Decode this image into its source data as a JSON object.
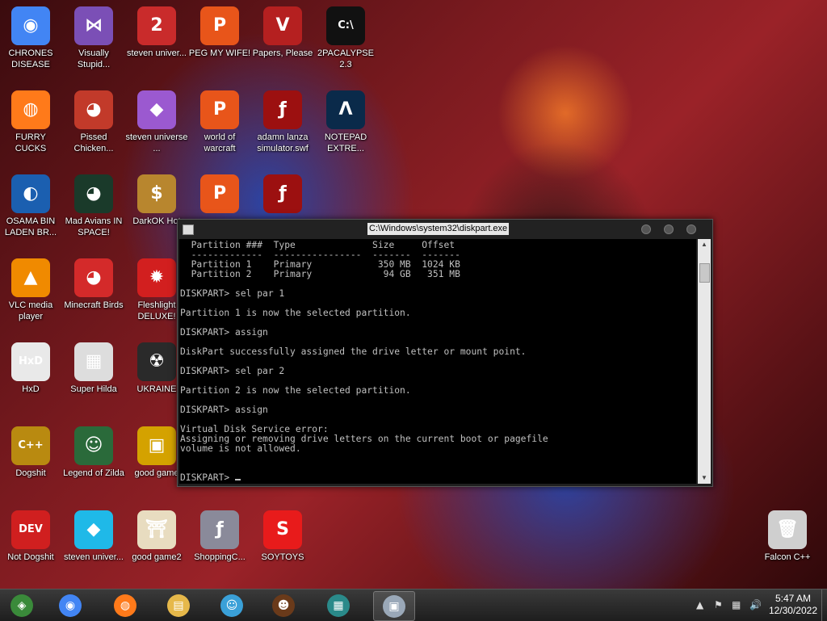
{
  "desktop": {
    "icons": [
      {
        "label": "CHRONES DISEASE",
        "icon": "chrome-icon",
        "color": "#4285f4",
        "glyph": "◉"
      },
      {
        "label": "Visually Stupid...",
        "icon": "visual-studio-icon",
        "color": "#7b4fb6",
        "glyph": "⋈"
      },
      {
        "label": "steven univer...",
        "icon": "pokemon-2-icon",
        "color": "#c92b2b",
        "glyph": "2"
      },
      {
        "label": "PEG MY WIFE!",
        "icon": "p-logo-icon",
        "color": "#e8551a",
        "glyph": "P"
      },
      {
        "label": "Papers, Please",
        "icon": "papers-please-icon",
        "color": "#b52020",
        "glyph": "V"
      },
      {
        "label": "2PACALYPSE 2.3",
        "icon": "cmd-icon",
        "color": "#111111",
        "glyph": "C:\\"
      },
      {
        "label": "FURRY CUCKS",
        "icon": "firefox-icon",
        "color": "#ff7a1a",
        "glyph": "◍"
      },
      {
        "label": "Pissed Chicken...",
        "icon": "angry-birds-seasons-icon",
        "color": "#c23a2a",
        "glyph": "◕"
      },
      {
        "label": "steven universe ...",
        "icon": "gem-icon",
        "color": "#9b59d0",
        "glyph": "◆"
      },
      {
        "label": "world of warcraft",
        "icon": "p-logo-icon",
        "color": "#e8551a",
        "glyph": "P"
      },
      {
        "label": "adamn lanza simulator.swf",
        "icon": "flash-icon",
        "color": "#9c1010",
        "glyph": "ƒ"
      },
      {
        "label": "NOTEPAD EXTRE...",
        "icon": "notepad-extreme-icon",
        "color": "#0a2a4a",
        "glyph": "Λ"
      },
      {
        "label": "OSAMA BIN LADEN BR...",
        "icon": "obama-logo-icon",
        "color": "#1b5fb0",
        "glyph": "◐"
      },
      {
        "label": "Mad Avians IN SPACE!",
        "icon": "angry-birds-space-icon",
        "color": "#1a3a2a",
        "glyph": "◕"
      },
      {
        "label": "DarkOK Hot",
        "icon": "money-bag-icon",
        "color": "#b8862e",
        "glyph": "$"
      },
      {
        "label": "VLC media player",
        "icon": "vlc-icon",
        "color": "#f08a00",
        "glyph": "▲"
      },
      {
        "label": "Minecraft Birds",
        "icon": "angry-birds-icon",
        "color": "#d42a2a",
        "glyph": "◕"
      },
      {
        "label": "Fleshlight DELUXE!",
        "icon": "red-monster-icon",
        "color": "#d21f1f",
        "glyph": "✹"
      },
      {
        "label": "HxD",
        "icon": "hxd-icon",
        "color": "#e9e9e9",
        "glyph": "HxD"
      },
      {
        "label": "Super Hilda",
        "icon": "pixel-dog-icon",
        "color": "#dddddd",
        "glyph": "▦"
      },
      {
        "label": "UKRAINE",
        "icon": "radiation-icon",
        "color": "#2a2a2a",
        "glyph": "☢"
      },
      {
        "label": "Dogshit",
        "icon": "code-blocks-icon",
        "color": "#b98a10",
        "glyph": "C++"
      },
      {
        "label": "Legend of Zilda",
        "icon": "pixel-character-icon",
        "color": "#2a6a3a",
        "glyph": "☺"
      },
      {
        "label": "good game",
        "icon": "mahjong-tile-icon",
        "color": "#d4a200",
        "glyph": "▣"
      },
      {
        "label": "Not Dogshit",
        "icon": "dev-cpp-icon",
        "color": "#d01f1f",
        "glyph": "DEV"
      },
      {
        "label": "steven univer...",
        "icon": "diamond-icon",
        "color": "#1fb9e8",
        "glyph": "◆"
      },
      {
        "label": "good game2",
        "icon": "torii-tile-icon",
        "color": "#e8dcc0",
        "glyph": "⛩"
      },
      {
        "label": "ShoppingC...",
        "icon": "flash-player-icon",
        "color": "#8a8a9a",
        "glyph": "ƒ"
      },
      {
        "label": "SOYTOYS",
        "icon": "red-s-icon",
        "color": "#e81b1b",
        "glyph": "S"
      },
      {
        "label": "Falcon C++",
        "icon": "recycle-bin-icon",
        "color": "#cfcfcf",
        "glyph": "🗑"
      }
    ],
    "extra_icons": [
      {
        "icon": "p-logo-icon",
        "color": "#e8551a",
        "glyph": "P"
      },
      {
        "icon": "flash-icon",
        "color": "#9c1010",
        "glyph": "ƒ"
      }
    ]
  },
  "console": {
    "title": "C:\\Windows\\system32\\diskpart.exe",
    "lines": [
      "  Partition ###  Type              Size     Offset",
      "  -------------  ----------------  -------  -------",
      "  Partition 1    Primary            350 MB  1024 KB",
      "  Partition 2    Primary             94 GB   351 MB",
      "",
      "DISKPART> sel par 1",
      "",
      "Partition 1 is now the selected partition.",
      "",
      "DISKPART> assign",
      "",
      "DiskPart successfully assigned the drive letter or mount point.",
      "",
      "DISKPART> sel par 2",
      "",
      "Partition 2 is now the selected partition.",
      "",
      "DISKPART> assign",
      "",
      "Virtual Disk Service error:",
      "Assigning or removing drive letters on the current boot or pagefile",
      "volume is not allowed.",
      "",
      ""
    ],
    "prompt": "DISKPART> "
  },
  "taskbar": {
    "buttons": [
      {
        "name": "start-button",
        "color": "#3a8a3a",
        "glyph": "◈"
      },
      {
        "name": "chrome-icon",
        "color": "#4285f4",
        "glyph": "◉"
      },
      {
        "name": "firefox-icon",
        "color": "#ff7a1a",
        "glyph": "◍"
      },
      {
        "name": "file-explorer-icon",
        "color": "#e6b84a",
        "glyph": "▤"
      },
      {
        "name": "people-icon",
        "color": "#3aa0d8",
        "glyph": "☺"
      },
      {
        "name": "game-character-icon",
        "color": "#6a3a1a",
        "glyph": "☻"
      },
      {
        "name": "pixel-app-icon",
        "color": "#2a8a8a",
        "glyph": "▦"
      },
      {
        "name": "console-window-icon",
        "color": "#9aa8b8",
        "glyph": "▣"
      }
    ],
    "clock": {
      "time": "5:47 AM",
      "date": "12/30/2022"
    }
  }
}
